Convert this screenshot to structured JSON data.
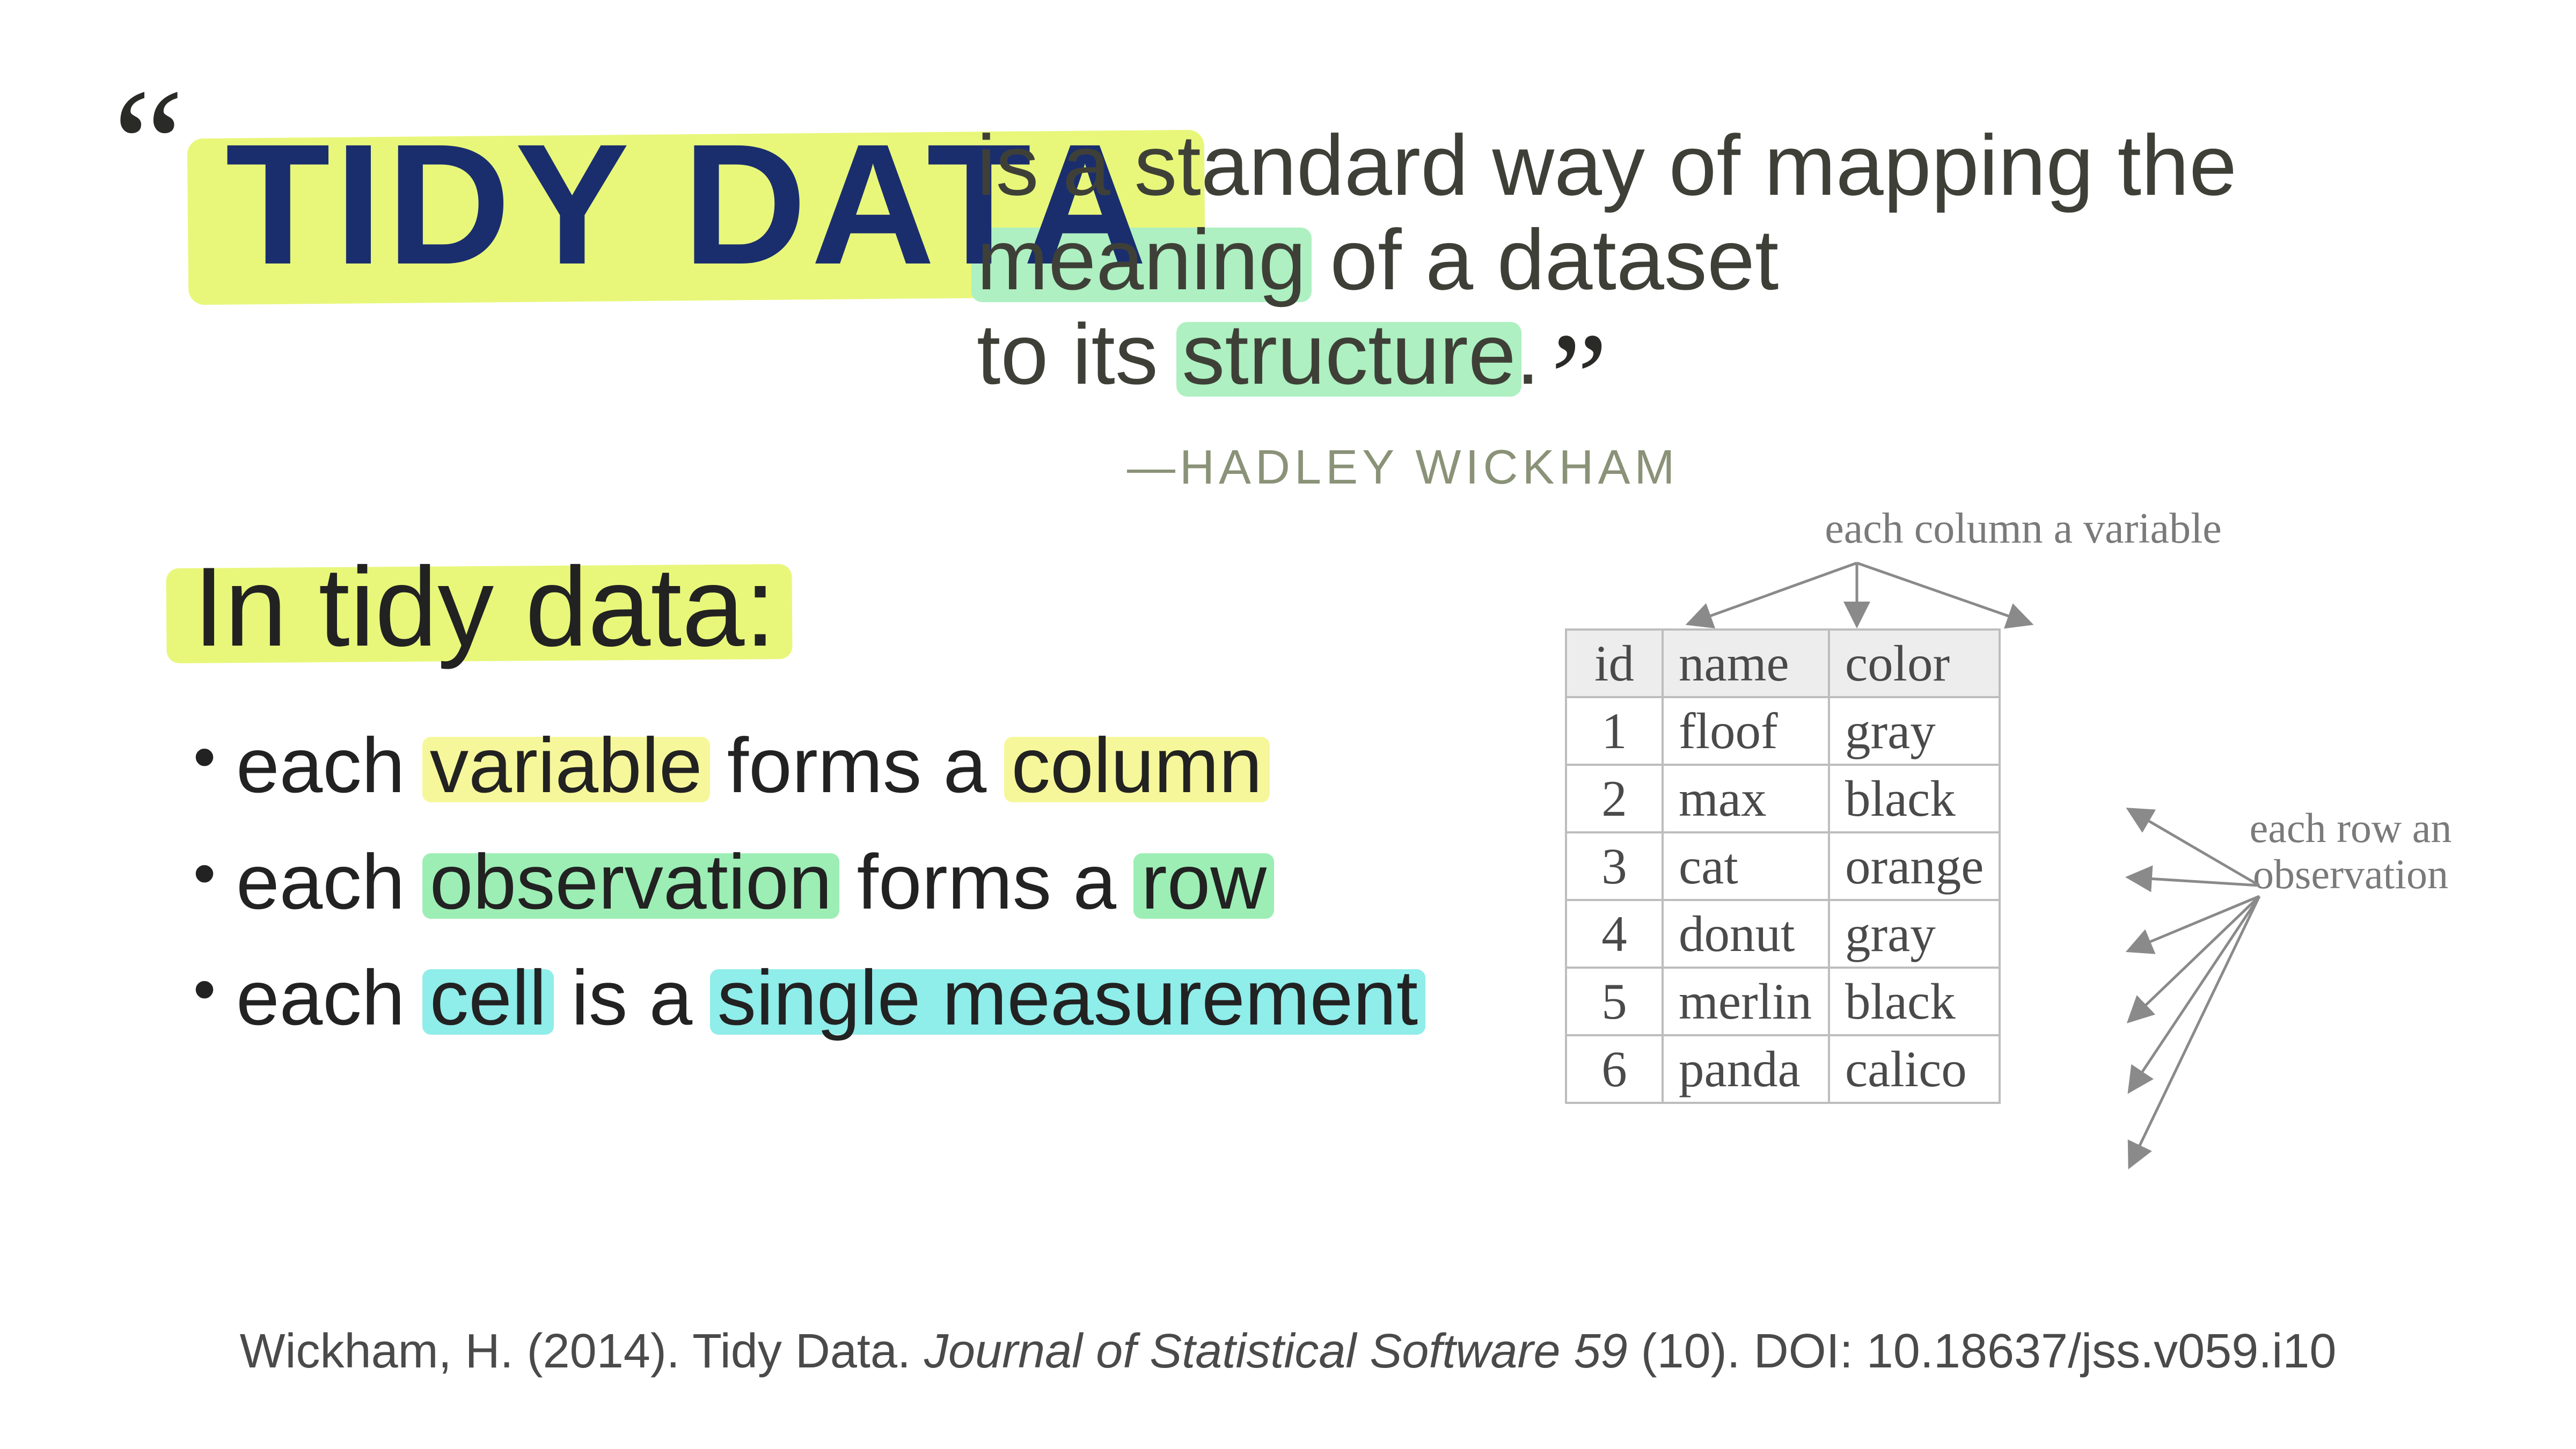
{
  "quote": {
    "title": "TIDY DATA",
    "line1": "is a standard way of mapping the",
    "line2a": "meaning",
    "line2b": " of a dataset",
    "line3a": "to its ",
    "line3b": "structure",
    "line3c": ".",
    "attribution": "—HADLEY WICKHAM"
  },
  "section": {
    "heading": "In tidy data:",
    "b1a": "each ",
    "b1b": "variable",
    "b1c": " forms a ",
    "b1d": "column",
    "b2a": "each ",
    "b2b": "observation",
    "b2c": " forms a ",
    "b2d": "row",
    "b3a": "each ",
    "b3b": "cell",
    "b3c": " is a ",
    "b3d": "single measurement"
  },
  "figure": {
    "col_label": "each column a variable",
    "row_label": "each row an observation",
    "headers": [
      "id",
      "name",
      "color"
    ],
    "rows": [
      [
        "1",
        "floof",
        "gray"
      ],
      [
        "2",
        "max",
        "black"
      ],
      [
        "3",
        "cat",
        "orange"
      ],
      [
        "4",
        "donut",
        "gray"
      ],
      [
        "5",
        "merlin",
        "black"
      ],
      [
        "6",
        "panda",
        "calico"
      ]
    ]
  },
  "citation": {
    "pre": "Wickham, H. (2014). Tidy Data. ",
    "journal": "Journal of Statistical Software 59",
    "post": " (10). DOI: 10.18637/jss.v059.i10"
  }
}
